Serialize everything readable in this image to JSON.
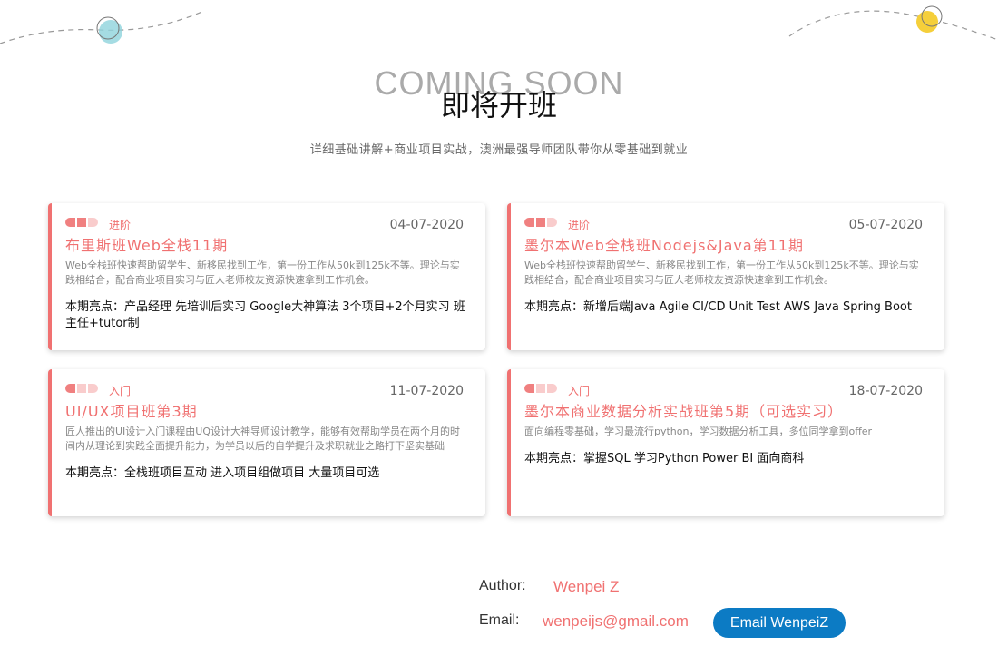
{
  "hero": {
    "ghost_title": "COMING SOON",
    "title": "即将开班",
    "subtitle": "详细基础讲解+商业项目实战，澳洲最强导师团队带你从零基础到就业"
  },
  "courses": [
    {
      "level": "进阶",
      "level_value": 2,
      "date": "04-07-2020",
      "title": "布里斯班Web全栈11期",
      "description": "Web全栈班快速帮助留学生、新移民找到工作，第一份工作从50k到125k不等。理论与实践相结合，配合商业项目实习与匠人老师校友资源快速拿到工作机会。",
      "highlight": "本期亮点：产品经理 先培训后实习 Google大神算法 3个项目+2个月实习 班主任+tutor制"
    },
    {
      "level": "进阶",
      "level_value": 2,
      "date": "05-07-2020",
      "title": "墨尔本Web全栈班Nodejs&Java第11期",
      "description": "Web全栈班快速帮助留学生、新移民找到工作，第一份工作从50k到125k不等。理论与实践相结合，配合商业项目实习与匠人老师校友资源快速拿到工作机会。",
      "highlight": "本期亮点：新增后端Java Agile CI/CD Unit Test AWS Java Spring Boot"
    },
    {
      "level": "入门",
      "level_value": 1,
      "date": "11-07-2020",
      "title": "UI/UX项目班第3期",
      "description": "匠人推出的UI设计入门课程由UQ设计大神导师设计教学，能够有效帮助学员在两个月的时间内从理论到实践全面提升能力，为学员以后的自学提升及求职就业之路打下坚实基础",
      "highlight": "本期亮点：全栈班项目互动 进入项目组做项目 大量项目可选"
    },
    {
      "level": "入门",
      "level_value": 1,
      "date": "18-07-2020",
      "title": "墨尔本商业数据分析实战班第5期（可选实习）",
      "description": "面向编程零基础，学习最流行python，学习数据分析工具，多位同学拿到offer",
      "highlight": "本期亮点：掌握SQL 学习Python Power BI 面向商科"
    }
  ],
  "footer": {
    "author_label": "Author:",
    "author_name": "Wenpei Z",
    "email_label": "Email:",
    "email": "wenpeijs@gmail.com",
    "email_button": "Email WenpeiZ"
  },
  "colors": {
    "accent": "#f07171",
    "button": "#0c7bc4"
  }
}
